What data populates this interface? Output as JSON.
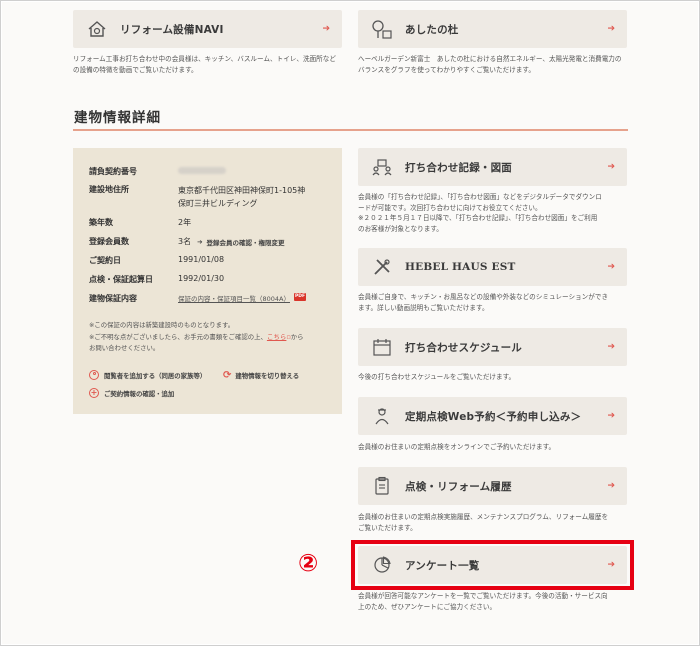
{
  "top_cards": {
    "reform": {
      "label": "リフォーム設備NAVI",
      "desc": "リフォーム工事お打ち合わせ中の会員様は、キッチン、バスルーム、トイレ、洗面所などの設備の特徴を動画でご覧いただけます。"
    },
    "ashita": {
      "label": "あしたの杜",
      "desc": "へーベルガーデン新富士　あしたの杜における自然エネルギー、太陽光発電と消費電力のバランスをグラフを使ってわかりやすくご覧いただけます。"
    }
  },
  "section": {
    "title": "建物情報詳細"
  },
  "info": {
    "contract_no_label": "請負契約番号",
    "address_label": "建設地住所",
    "address_value_1": "東京都千代田区神田神保町1-105神",
    "address_value_2": "保町三井ビルディング",
    "age_label": "築年数",
    "age_value": "2年",
    "members_label": "登録会員数",
    "members_value": "3名",
    "members_link": "登録会員の確認・権限変更",
    "contract_date_label": "ご契約日",
    "contract_date_value": "1991/01/08",
    "warranty_start_label": "点検・保証起算日",
    "warranty_start_value": "1992/01/30",
    "warranty_label": "建物保証内容",
    "warranty_link": "保証の内容・保証項目一覧（8004A）",
    "pdf_badge": "PDF",
    "note_1": "※この保証の内容は新築建設時のものとなります。",
    "note_2a": "※ご不明な点がございましたら、お手元の書類をご確認の上、",
    "note_2_link": "こちら",
    "note_2b": "から",
    "note_2c": "お問い合わせください。",
    "action_add_viewer": "閲覧者を追加する（同居の家族等）",
    "action_switch": "建物情報を切り替える",
    "action_contract": "ご契約情報の確認・追加"
  },
  "right_cards": [
    {
      "label": "打ち合わせ記録・図面",
      "icon": "people-meeting-icon",
      "desc_1": "会員様の「打ち合わせ記録」、「打ち合わせ図面」などをデジタルデータでダウンロ",
      "desc_2": "ードが可能です。次回打ち合わせに向けてお役立てください。",
      "desc_3": "※２０２１年５月１７日以降で、「打ち合わせ記録」、「打ち合わせ図面」をご利用",
      "desc_4": "のお客様が対象となります。"
    },
    {
      "label": "HEBEL HAUS EST",
      "icon": "tools-icon",
      "desc_1": "会員様ご自身で、キッチン・お風呂などの設備や外装などのシミュレーションができ",
      "desc_2": "ます。詳しい動画説明もご覧いただけます。"
    },
    {
      "label": "打ち合わせスケジュール",
      "icon": "calendar-icon",
      "desc_1": "今後の打ち合わせスケジュールをご覧いただけます。"
    },
    {
      "label": "定期点検Web予約＜予約申し込み＞",
      "icon": "inspector-icon",
      "desc_1": "会員様のお住まいの定期点検をオンラインでご予約いただけます。"
    },
    {
      "label": "点検・リフォーム履歴",
      "icon": "clipboard-icon",
      "desc_1": "会員様のお住まいの定期点検実施履歴、メンテナンスプログラム、リフォーム履歴を",
      "desc_2": "ご覧いただけます。"
    },
    {
      "label": "アンケート一覧",
      "icon": "pie-chart-icon",
      "desc_1": "会員様が回答可能なアンケートを一覧でご覧いただけます。今後の活動・サービス向",
      "desc_2": "上のため、ぜひアンケートにご協力ください。"
    }
  ],
  "annotation": {
    "marker": "②"
  },
  "colors": {
    "accent": "#e0584f",
    "card_bg": "#eeeae4",
    "panel_bg": "#ece5d6",
    "highlight": "#e60012"
  }
}
